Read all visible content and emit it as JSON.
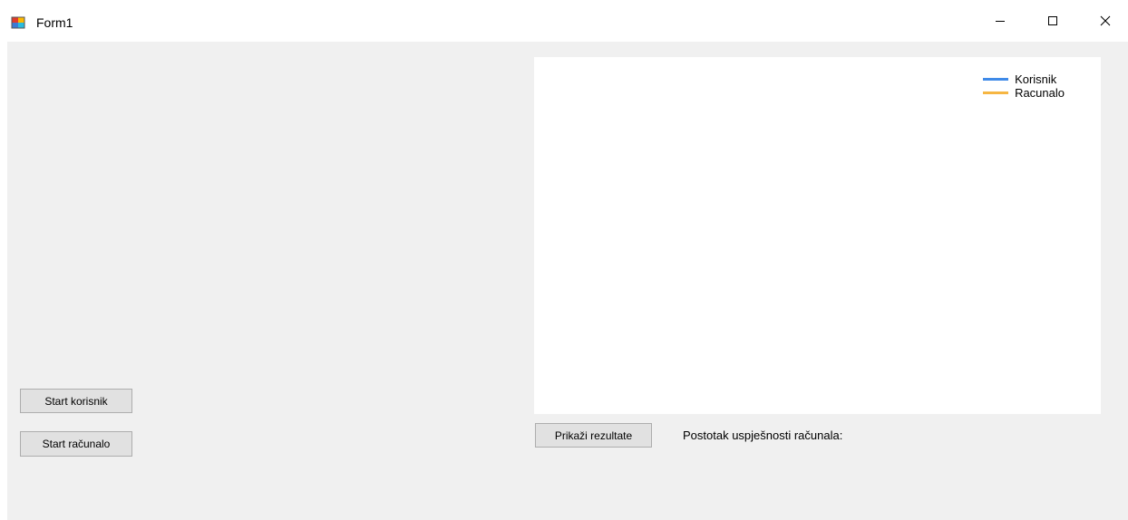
{
  "window": {
    "title": "Form1",
    "controls": {
      "minimize": "minimize-icon",
      "maximize": "maximize-icon",
      "close": "close-icon"
    }
  },
  "left_panel": {
    "start_korisnik_label": "Start korisnik",
    "start_racunalo_label": "Start računalo"
  },
  "chart": {
    "legend": [
      {
        "name": "Korisnik",
        "color": "#3f8ae8"
      },
      {
        "name": "Racunalo",
        "color": "#f6b642"
      }
    ]
  },
  "results": {
    "button_label": "Prikaži rezultate",
    "success_label": "Postotak uspješnosti računala:"
  },
  "colors": {
    "client_background": "#f0f0f0",
    "button_background": "#e1e1e1",
    "button_border": "#adadad"
  }
}
